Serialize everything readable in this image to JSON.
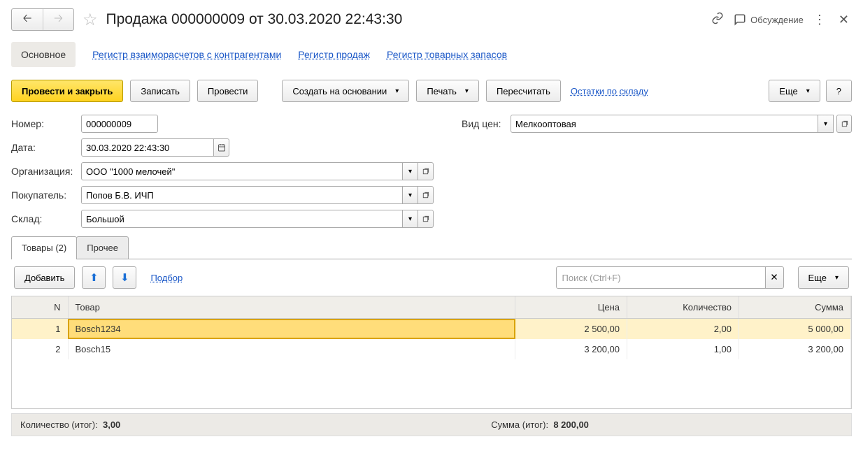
{
  "title": "Продажа 000000009 от 30.03.2020 22:43:30",
  "titlebar": {
    "discuss": "Обсуждение"
  },
  "nav": {
    "main": "Основное",
    "links": [
      "Регистр взаиморасчетов с контрагентами",
      "Регистр продаж",
      "Регистр товарных запасов"
    ]
  },
  "toolbar": {
    "post_close": "Провести и закрыть",
    "save": "Записать",
    "post": "Провести",
    "create_based": "Создать на основании",
    "print": "Печать",
    "recalc": "Пересчитать",
    "stock_link": "Остатки по складу",
    "more": "Еще",
    "help": "?"
  },
  "form": {
    "number_label": "Номер:",
    "number_value": "000000009",
    "date_label": "Дата:",
    "date_value": "30.03.2020 22:43:30",
    "org_label": "Организация:",
    "org_value": "ООО \"1000 мелочей\"",
    "buyer_label": "Покупатель:",
    "buyer_value": "Попов Б.В. ИЧП",
    "warehouse_label": "Склад:",
    "warehouse_value": "Большой",
    "price_type_label": "Вид цен:",
    "price_type_value": "Мелкооптовая"
  },
  "tabs": {
    "goods": "Товары (2)",
    "other": "Прочее"
  },
  "tab_toolbar": {
    "add": "Добавить",
    "select": "Подбор",
    "search_placeholder": "Поиск (Ctrl+F)",
    "more": "Еще"
  },
  "table": {
    "headers": {
      "n": "N",
      "product": "Товар",
      "price": "Цена",
      "qty": "Количество",
      "sum": "Сумма"
    },
    "rows": [
      {
        "n": "1",
        "product": "Bosch1234",
        "price": "2 500,00",
        "qty": "2,00",
        "sum": "5 000,00"
      },
      {
        "n": "2",
        "product": "Bosch15",
        "price": "3 200,00",
        "qty": "1,00",
        "sum": "3 200,00"
      }
    ]
  },
  "totals": {
    "qty_label": "Количество (итог):",
    "qty_value": "3,00",
    "sum_label": "Сумма (итог):",
    "sum_value": "8 200,00"
  }
}
